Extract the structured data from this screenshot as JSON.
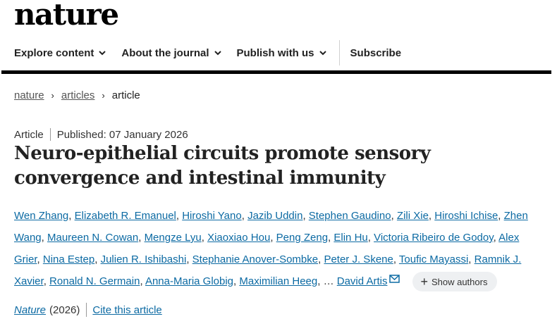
{
  "header": {
    "logo": "nature"
  },
  "nav": {
    "explore": "Explore content",
    "about": "About the journal",
    "publish": "Publish with us",
    "subscribe": "Subscribe"
  },
  "breadcrumb": {
    "home": "nature",
    "section": "articles",
    "current": "article",
    "sep": "›"
  },
  "article": {
    "type": "Article",
    "published": "Published: 07 January 2026",
    "title": "Neuro-epithelial circuits promote sensory convergence and intestinal immunity"
  },
  "authors": [
    "Wen Zhang",
    "Elizabeth R. Emanuel",
    "Hiroshi Yano",
    "Jazib Uddin",
    "Stephen Gaudino",
    "Zili Xie",
    "Hiroshi Ichise",
    "Zhen Wang",
    "Maureen N. Cowan",
    "Mengze Lyu",
    "Xiaoxiao Hou",
    "Peng Zeng",
    "Elin Hu",
    "Victoria Ribeiro de Godoy",
    "Alex Grier",
    "Nina Estep",
    "Julien R. Ishibashi",
    "Stephanie Anover-Sombke",
    "Peter J. Skene",
    "Toufic Mayassi",
    "Ramnik J. Xavier",
    "Ronald N. Germain",
    "Anna-Maria Globig",
    "Maximilian Heeg"
  ],
  "ellipsis": "…",
  "corresponding_author": "David Artis",
  "show_authors": "Show authors",
  "footer": {
    "journal": "Nature",
    "year": "(2026)",
    "cite": "Cite this article"
  },
  "icons": {
    "nav_chevron": "chevron-down-icon",
    "breadcrumb_sep": "chevron-right-icon",
    "mail": "envelope-icon",
    "plus": "plus-icon"
  },
  "colors": {
    "link": "#0c6aa3",
    "text": "#222222",
    "rule": "#000000",
    "button_bg": "#eef0f2"
  }
}
